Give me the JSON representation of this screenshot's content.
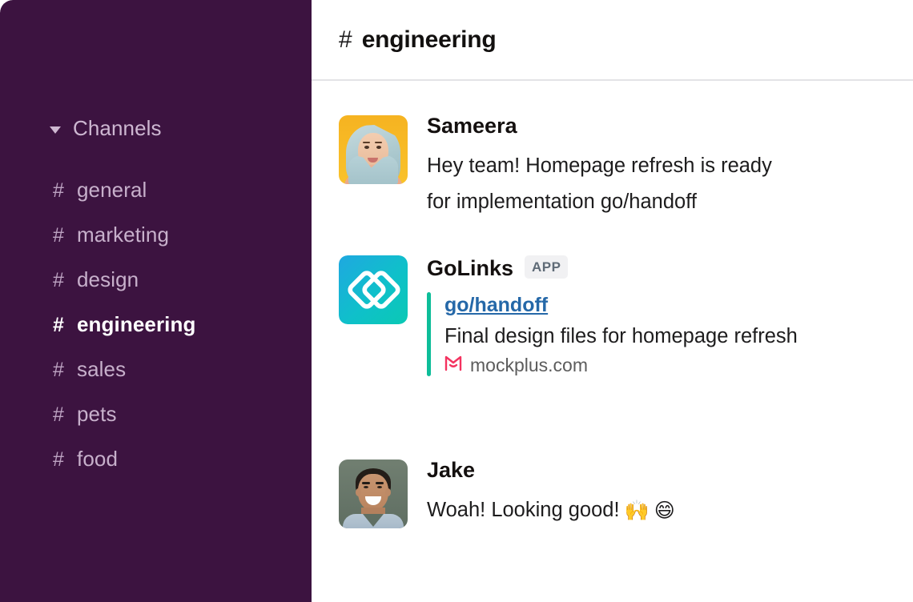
{
  "sidebar": {
    "section_label": "Channels",
    "caret_icon": "chevron-down-icon",
    "hash_glyph": "#",
    "channels": [
      {
        "name": "general",
        "active": false
      },
      {
        "name": "marketing",
        "active": false
      },
      {
        "name": "design",
        "active": false
      },
      {
        "name": "engineering",
        "active": true
      },
      {
        "name": "sales",
        "active": false
      },
      {
        "name": "pets",
        "active": false
      },
      {
        "name": "food",
        "active": false
      }
    ],
    "background_color": "#3c1340",
    "text_color": "#c7b0cb",
    "active_text_color": "#ffffff"
  },
  "header": {
    "hash_glyph": "#",
    "channel_name": "engineering"
  },
  "messages": [
    {
      "author": "Sameera",
      "avatar_icon": "avatar-sameera",
      "text_line_1": "Hey team! Homepage refresh is ready",
      "text_line_2": "for implementation go/handoff"
    },
    {
      "author": "GoLinks",
      "avatar_icon": "golinks-app-icon",
      "badge": "APP",
      "attachment": {
        "link_text": "go/handoff",
        "link_color": "#2568a8",
        "description": "Final design files for homepage refresh",
        "source_icon": "mockplus-favicon",
        "source_name": "mockplus.com",
        "accent_color": "#0dbd99"
      }
    },
    {
      "author": "Jake",
      "avatar_icon": "avatar-jake",
      "text": "Woah! Looking good!",
      "emoji_1": "🙌",
      "emoji_2": "😄"
    }
  ]
}
